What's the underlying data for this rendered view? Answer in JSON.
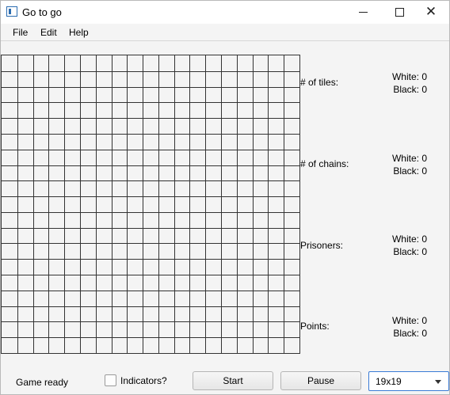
{
  "window": {
    "title": "Go to go"
  },
  "menu": {
    "file": "File",
    "edit": "Edit",
    "help": "Help"
  },
  "board": {
    "rows": 19,
    "cols": 19,
    "line_color": "#333333",
    "background": "#f4f4f4"
  },
  "stats": {
    "tiles": {
      "label": "# of tiles:",
      "white": "White: 0",
      "black": "Black: 0"
    },
    "chains": {
      "label": "# of chains:",
      "white": "White: 0",
      "black": "Black: 0"
    },
    "prisoners": {
      "label": "Prisoners:",
      "white": "White: 0",
      "black": "Black: 0"
    },
    "points": {
      "label": "Points:",
      "white": "White: 0",
      "black": "Black: 0"
    }
  },
  "footer": {
    "status": "Game ready",
    "indicators_label": "Indicators?",
    "indicators_checked": false,
    "start_label": "Start",
    "pause_label": "Pause",
    "size_selected": "19x19"
  },
  "colors": {
    "select_border": "#3a7bd5"
  },
  "icons": {
    "app": "app-window-icon",
    "minimize": "minimize-icon",
    "maximize": "maximize-icon",
    "close": "close-icon",
    "dropdown": "chevron-down-icon"
  }
}
